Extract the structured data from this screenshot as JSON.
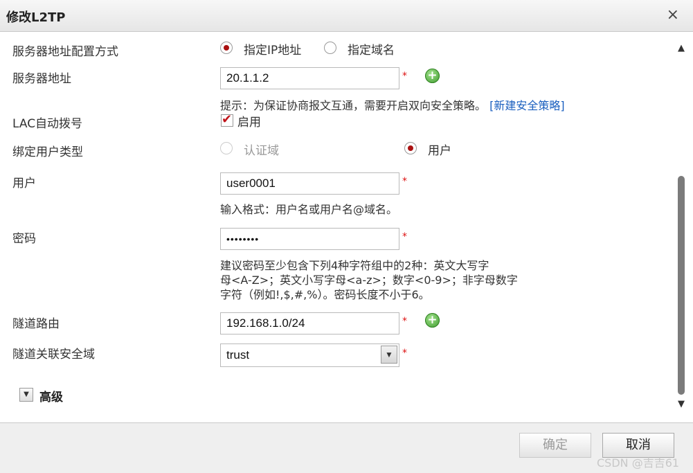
{
  "dialog": {
    "title": "修改L2TP",
    "close_glyph": "×"
  },
  "form": {
    "server_mode": {
      "label": "服务器地址配置方式",
      "options": [
        "指定IP地址",
        "指定域名"
      ],
      "selected": "指定IP地址"
    },
    "server_address": {
      "label": "服务器地址",
      "value": "20.1.1.2",
      "required_mark": "*"
    },
    "security_hint": {
      "text": "提示：为保证协商报文互通，需要开启双向安全策略。",
      "link": "[新建安全策略]"
    },
    "lac_dial": {
      "label": "LAC自动拨号",
      "checkbox_label": "启用",
      "checked": true
    },
    "bind_user_type": {
      "label": "绑定用户类型",
      "options": [
        "认证域",
        "用户"
      ],
      "selected": "用户"
    },
    "user": {
      "label": "用户",
      "value": "user0001",
      "required_mark": "*",
      "hint": "输入格式：用户名或用户名@域名。"
    },
    "password": {
      "label": "密码",
      "value": "••••••••",
      "required_mark": "*",
      "hint_lines": [
        "建议密码至少包含下列4种字符组中的2种：英文大写字",
        "母<A-Z>；英文小写字母<a-z>；数字<0-9>；非字母数字",
        "字符（例如!,$,#,%）。密码长度不小于6。"
      ]
    },
    "tunnel_route": {
      "label": "隧道路由",
      "value": "192.168.1.0/24",
      "required_mark": "*"
    },
    "tunnel_zone": {
      "label": "隧道关联安全域",
      "value": "trust",
      "required_mark": "*"
    },
    "advanced": {
      "label": "高级"
    }
  },
  "icons": {
    "add": "+",
    "dropdown": "▼",
    "expand": "▼",
    "scroll_up": "▲",
    "scroll_down": "▼"
  },
  "footer": {
    "ok_label": "确定",
    "cancel_label": "取消",
    "watermark": "CSDN @吉吉61"
  }
}
